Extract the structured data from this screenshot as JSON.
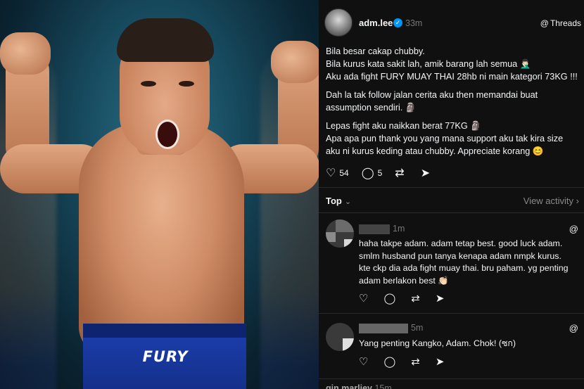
{
  "post": {
    "username": "adm.lee",
    "time": "33m",
    "threads_label": "Threads",
    "lines": [
      "Bila besar cakap chubby.",
      "Bila kurus kata sakit lah, amik barang lah semua 🤦🏻‍♂️",
      "Aku ada fight FURY MUAY THAI 28hb ni main kategori 73KG !!!"
    ],
    "para2": [
      "Dah la tak follow jalan cerita aku then memandai buat",
      "assumption sendiri. 🗿"
    ],
    "para3": [
      "Lepas fight aku naikkan berat 77KG 🗿",
      "Apa apa pun thank you yang mana support aku tak kira size",
      "aku ni kurus keding atau chubby. Appreciate korang 😊"
    ],
    "likes": "54",
    "replies": "5"
  },
  "sort": {
    "label": "Top",
    "view_activity": "View activity"
  },
  "comments": [
    {
      "time": "1m",
      "lines": [
        "haha takpe adam. adam tetap best. good luck adam.",
        "smlm husband pun tanya kenapa adam nmpk kurus.",
        "kte ckp dia ada fight muay thai. bru paham. yg penting",
        "adam berlakon best 👏🏻"
      ]
    },
    {
      "time": "5m",
      "lines": [
        "Yang penting Kangko, Adam. Chok! (ซก)"
      ]
    }
  ],
  "next_comment": {
    "name": "gin.marliey",
    "time": "15m"
  },
  "photo": {
    "shorts_logo": "FURY"
  },
  "icons": {
    "like": "heart-icon",
    "reply": "comment-icon",
    "repost": "repost-icon",
    "share": "share-icon",
    "threads": "threads-logo-icon",
    "verified": "verified-badge-icon"
  },
  "colors": {
    "panel_bg": "#101010",
    "verified": "#0095f6",
    "muted": "#777777"
  }
}
